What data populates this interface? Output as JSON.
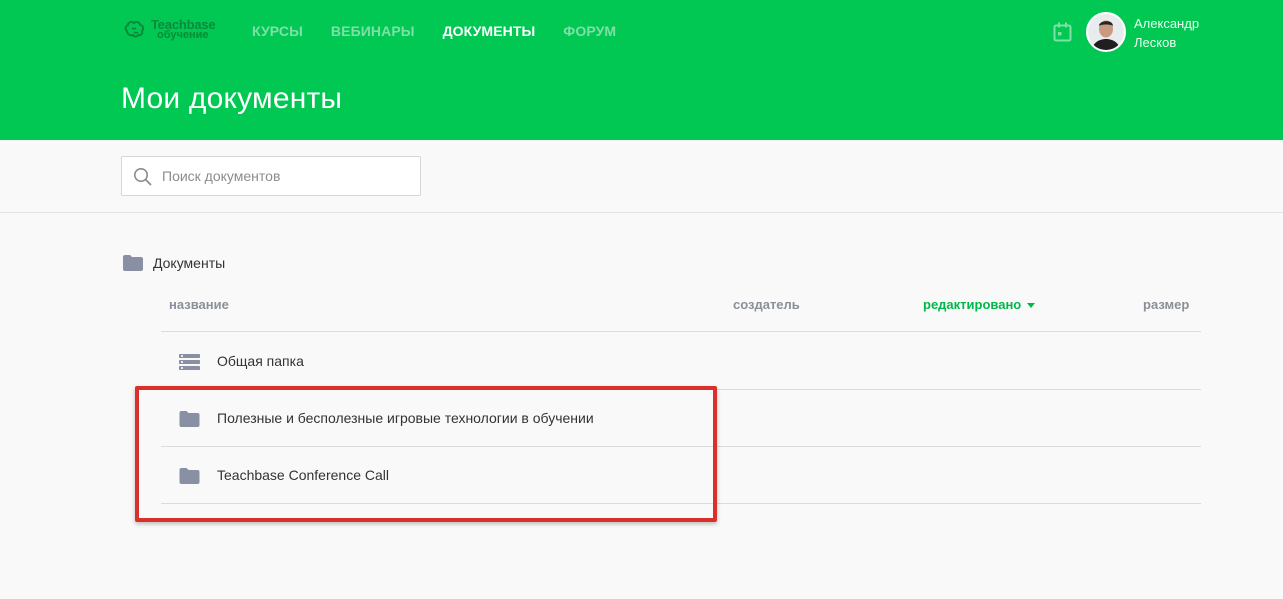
{
  "logo": {
    "line1": "Teachbase",
    "line2": "обучение"
  },
  "nav": [
    {
      "label": "КУРСЫ",
      "active": false
    },
    {
      "label": "ВЕБИНАРЫ",
      "active": false
    },
    {
      "label": "ДОКУМЕНТЫ",
      "active": true
    },
    {
      "label": "ФОРУМ",
      "active": false
    }
  ],
  "header": {
    "calendar_icon": "calendar-icon"
  },
  "user": {
    "first_name": "Александр",
    "last_name": "Лесков"
  },
  "page": {
    "title": "Мои документы"
  },
  "search": {
    "placeholder": "Поиск документов",
    "value": "",
    "icon": "search-icon"
  },
  "breadcrumb": {
    "label": "Документы",
    "icon": "folder-icon"
  },
  "table": {
    "columns": {
      "name": "название",
      "creator": "создатель",
      "edited": "редактировано",
      "size": "размер"
    },
    "sorted_by": "edited",
    "rows": [
      {
        "icon": "shared-folder-icon",
        "name": "Общая папка",
        "creator": "",
        "edited": "",
        "size": ""
      },
      {
        "icon": "folder-icon",
        "name": "Полезные и бесполезные игровые технологии в обучении",
        "creator": "",
        "edited": "",
        "size": ""
      },
      {
        "icon": "folder-icon",
        "name": "Teachbase Conference Call",
        "creator": "",
        "edited": "",
        "size": ""
      }
    ]
  },
  "colors": {
    "brand_green": "#00c853",
    "sort_accent": "#00b84a",
    "highlight_red": "#d9302c",
    "folder_icon": "#8a90a3"
  }
}
